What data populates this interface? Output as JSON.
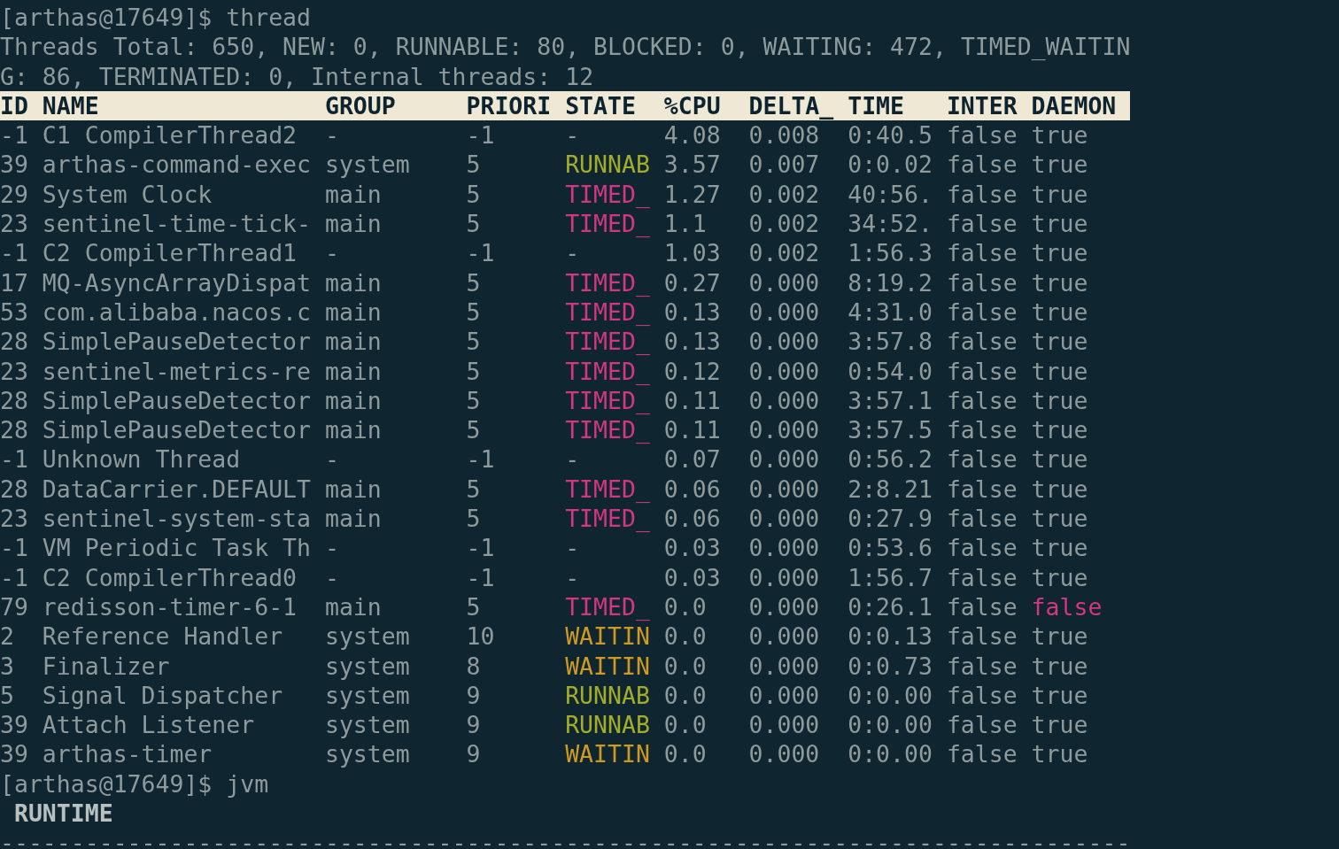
{
  "prompt_lines": [
    {
      "prompt": "[arthas@17649]$",
      "command": "thread"
    }
  ],
  "summary": [
    "Threads Total: 650, NEW: 0, RUNNABLE: 80, BLOCKED: 0, WAITING: 472, TIMED_WAITIN",
    "G: 86, TERMINATED: 0, Internal threads: 12"
  ],
  "table": {
    "columns": [
      "ID",
      "NAME",
      "GROUP",
      "PRIORI",
      "STATE",
      "%CPU",
      "DELTA_",
      "TIME",
      "INTER",
      "DAEMON"
    ],
    "rows": [
      {
        "id": "-1",
        "name": "C1 CompilerThread2",
        "group": "-",
        "priority": "-1",
        "state": {
          "text": "-",
          "color": "#8e9a9b"
        },
        "cpu": "4.08",
        "delta": "0.008",
        "time": "0:40.5",
        "interrupted": "false",
        "daemon": {
          "text": "true",
          "color": "#8e9a9b"
        }
      },
      {
        "id": "39",
        "name": "arthas-command-exec",
        "group": "system",
        "priority": "5",
        "state": {
          "text": "RUNNAB",
          "color": "#a3ad2a"
        },
        "cpu": "3.57",
        "delta": "0.007",
        "time": "0:0.02",
        "interrupted": "false",
        "daemon": {
          "text": "true",
          "color": "#8e9a9b"
        }
      },
      {
        "id": "29",
        "name": "System Clock",
        "group": "main",
        "priority": "5",
        "state": {
          "text": "TIMED_",
          "color": "#d33682"
        },
        "cpu": "1.27",
        "delta": "0.002",
        "time": "40:56.",
        "interrupted": "false",
        "daemon": {
          "text": "true",
          "color": "#8e9a9b"
        }
      },
      {
        "id": "23",
        "name": "sentinel-time-tick-",
        "group": "main",
        "priority": "5",
        "state": {
          "text": "TIMED_",
          "color": "#d33682"
        },
        "cpu": "1.1",
        "delta": "0.002",
        "time": "34:52.",
        "interrupted": "false",
        "daemon": {
          "text": "true",
          "color": "#8e9a9b"
        }
      },
      {
        "id": "-1",
        "name": "C2 CompilerThread1",
        "group": "-",
        "priority": "-1",
        "state": {
          "text": "-",
          "color": "#8e9a9b"
        },
        "cpu": "1.03",
        "delta": "0.002",
        "time": "1:56.3",
        "interrupted": "false",
        "daemon": {
          "text": "true",
          "color": "#8e9a9b"
        }
      },
      {
        "id": "17",
        "name": "MQ-AsyncArrayDispat",
        "group": "main",
        "priority": "5",
        "state": {
          "text": "TIMED_",
          "color": "#d33682"
        },
        "cpu": "0.27",
        "delta": "0.000",
        "time": "8:19.2",
        "interrupted": "false",
        "daemon": {
          "text": "true",
          "color": "#8e9a9b"
        }
      },
      {
        "id": "53",
        "name": "com.alibaba.nacos.c",
        "group": "main",
        "priority": "5",
        "state": {
          "text": "TIMED_",
          "color": "#d33682"
        },
        "cpu": "0.13",
        "delta": "0.000",
        "time": "4:31.0",
        "interrupted": "false",
        "daemon": {
          "text": "true",
          "color": "#8e9a9b"
        }
      },
      {
        "id": "28",
        "name": "SimplePauseDetector",
        "group": "main",
        "priority": "5",
        "state": {
          "text": "TIMED_",
          "color": "#d33682"
        },
        "cpu": "0.13",
        "delta": "0.000",
        "time": "3:57.8",
        "interrupted": "false",
        "daemon": {
          "text": "true",
          "color": "#8e9a9b"
        }
      },
      {
        "id": "23",
        "name": "sentinel-metrics-re",
        "group": "main",
        "priority": "5",
        "state": {
          "text": "TIMED_",
          "color": "#d33682"
        },
        "cpu": "0.12",
        "delta": "0.000",
        "time": "0:54.0",
        "interrupted": "false",
        "daemon": {
          "text": "true",
          "color": "#8e9a9b"
        }
      },
      {
        "id": "28",
        "name": "SimplePauseDetector",
        "group": "main",
        "priority": "5",
        "state": {
          "text": "TIMED_",
          "color": "#d33682"
        },
        "cpu": "0.11",
        "delta": "0.000",
        "time": "3:57.1",
        "interrupted": "false",
        "daemon": {
          "text": "true",
          "color": "#8e9a9b"
        }
      },
      {
        "id": "28",
        "name": "SimplePauseDetector",
        "group": "main",
        "priority": "5",
        "state": {
          "text": "TIMED_",
          "color": "#d33682"
        },
        "cpu": "0.11",
        "delta": "0.000",
        "time": "3:57.5",
        "interrupted": "false",
        "daemon": {
          "text": "true",
          "color": "#8e9a9b"
        }
      },
      {
        "id": "-1",
        "name": "Unknown Thread",
        "group": "-",
        "priority": "-1",
        "state": {
          "text": "-",
          "color": "#8e9a9b"
        },
        "cpu": "0.07",
        "delta": "0.000",
        "time": "0:56.2",
        "interrupted": "false",
        "daemon": {
          "text": "true",
          "color": "#8e9a9b"
        }
      },
      {
        "id": "28",
        "name": "DataCarrier.DEFAULT",
        "group": "main",
        "priority": "5",
        "state": {
          "text": "TIMED_",
          "color": "#d33682"
        },
        "cpu": "0.06",
        "delta": "0.000",
        "time": "2:8.21",
        "interrupted": "false",
        "daemon": {
          "text": "true",
          "color": "#8e9a9b"
        }
      },
      {
        "id": "23",
        "name": "sentinel-system-sta",
        "group": "main",
        "priority": "5",
        "state": {
          "text": "TIMED_",
          "color": "#d33682"
        },
        "cpu": "0.06",
        "delta": "0.000",
        "time": "0:27.9",
        "interrupted": "false",
        "daemon": {
          "text": "true",
          "color": "#8e9a9b"
        }
      },
      {
        "id": "-1",
        "name": "VM Periodic Task Th",
        "group": "-",
        "priority": "-1",
        "state": {
          "text": "-",
          "color": "#8e9a9b"
        },
        "cpu": "0.03",
        "delta": "0.000",
        "time": "0:53.6",
        "interrupted": "false",
        "daemon": {
          "text": "true",
          "color": "#8e9a9b"
        }
      },
      {
        "id": "-1",
        "name": "C2 CompilerThread0",
        "group": "-",
        "priority": "-1",
        "state": {
          "text": "-",
          "color": "#8e9a9b"
        },
        "cpu": "0.03",
        "delta": "0.000",
        "time": "1:56.7",
        "interrupted": "false",
        "daemon": {
          "text": "true",
          "color": "#8e9a9b"
        }
      },
      {
        "id": "79",
        "name": "redisson-timer-6-1",
        "group": "main",
        "priority": "5",
        "state": {
          "text": "TIMED_",
          "color": "#d33682"
        },
        "cpu": "0.0",
        "delta": "0.000",
        "time": "0:26.1",
        "interrupted": "false",
        "daemon": {
          "text": "false",
          "color": "#d33682"
        }
      },
      {
        "id": "2",
        "name": "Reference Handler",
        "group": "system",
        "priority": "10",
        "state": {
          "text": "WAITIN",
          "color": "#cf9a21"
        },
        "cpu": "0.0",
        "delta": "0.000",
        "time": "0:0.13",
        "interrupted": "false",
        "daemon": {
          "text": "true",
          "color": "#8e9a9b"
        }
      },
      {
        "id": "3",
        "name": "Finalizer",
        "group": "system",
        "priority": "8",
        "state": {
          "text": "WAITIN",
          "color": "#cf9a21"
        },
        "cpu": "0.0",
        "delta": "0.000",
        "time": "0:0.73",
        "interrupted": "false",
        "daemon": {
          "text": "true",
          "color": "#8e9a9b"
        }
      },
      {
        "id": "5",
        "name": "Signal Dispatcher",
        "group": "system",
        "priority": "9",
        "state": {
          "text": "RUNNAB",
          "color": "#a3ad2a"
        },
        "cpu": "0.0",
        "delta": "0.000",
        "time": "0:0.00",
        "interrupted": "false",
        "daemon": {
          "text": "true",
          "color": "#8e9a9b"
        }
      },
      {
        "id": "39",
        "name": "Attach Listener",
        "group": "system",
        "priority": "9",
        "state": {
          "text": "RUNNAB",
          "color": "#a3ad2a"
        },
        "cpu": "0.0",
        "delta": "0.000",
        "time": "0:0.00",
        "interrupted": "false",
        "daemon": {
          "text": "true",
          "color": "#8e9a9b"
        }
      },
      {
        "id": "39",
        "name": "arthas-timer",
        "group": "system",
        "priority": "9",
        "state": {
          "text": "WAITIN",
          "color": "#cf9a21"
        },
        "cpu": "0.0",
        "delta": "0.000",
        "time": "0:0.00",
        "interrupted": "false",
        "daemon": {
          "text": "true",
          "color": "#8e9a9b"
        }
      }
    ]
  },
  "next_prompt": {
    "prompt": "[arthas@17649]$",
    "command": "jvm"
  },
  "section_heading": "RUNTIME",
  "separator": "--------------------------------------------------------------------------------"
}
